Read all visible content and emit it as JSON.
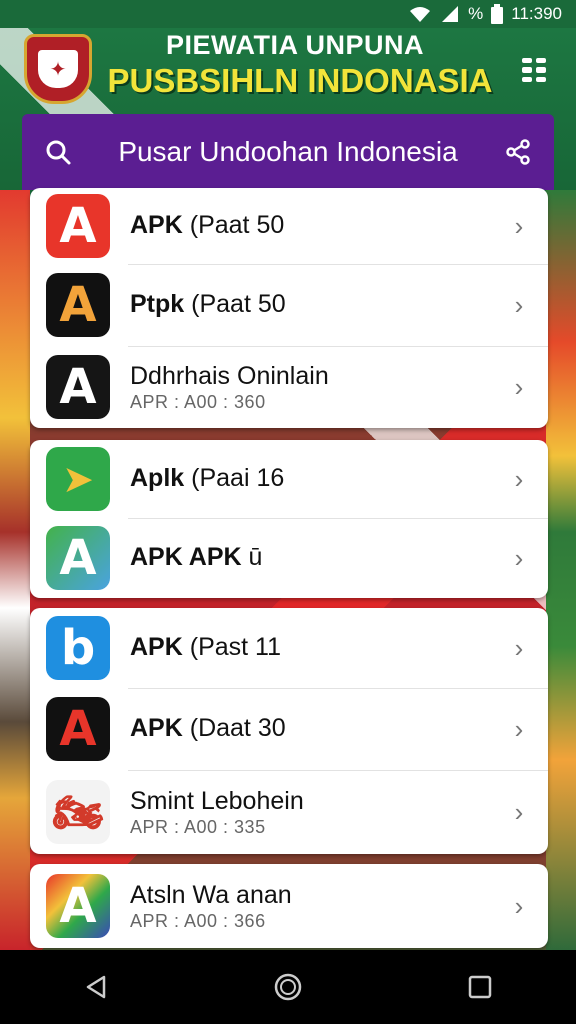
{
  "status_bar": {
    "percent": "%",
    "time": "11:390"
  },
  "header": {
    "line1": "PIEWATIA UNPUNA",
    "line2": "PUSBSIHLN INDONASIA"
  },
  "search_bar": {
    "title": "Pusar Undoohan Indonesia",
    "search_icon": "search-icon",
    "share_icon": "share-icon"
  },
  "cards": [
    {
      "items": [
        {
          "title_bold": "APK",
          "title_rest": " (Paat 50",
          "subtitle": "",
          "icon": "letter-a-red-icon",
          "icon_color": "#e8352a",
          "icon_letter": "A"
        },
        {
          "title_bold": "Ptpk",
          "title_rest": " (Paat 50",
          "subtitle": "",
          "icon": "letter-a-black-orange-icon",
          "icon_color": "#111111",
          "icon_letter": "A"
        },
        {
          "title_bold": "",
          "title_rest": "Ddhrhais Oninlain",
          "subtitle": "APR :  A00 : 360",
          "icon": "letter-a-black-white-icon",
          "icon_color": "#151515",
          "icon_letter": "A"
        }
      ]
    },
    {
      "items": [
        {
          "title_bold": "Aplk",
          "title_rest": " (Paai 16",
          "subtitle": "",
          "icon": "green-arrow-icon",
          "icon_color": "#2fa84a",
          "icon_letter": "➤"
        },
        {
          "title_bold": "APK APK",
          "title_rest": " ū",
          "subtitle": "",
          "icon": "letter-a-green-blue-icon",
          "icon_color": "#43b24a",
          "icon_letter": "A"
        }
      ]
    },
    {
      "items": [
        {
          "title_bold": "APK",
          "title_rest": " (Past 11",
          "subtitle": "",
          "icon": "letter-b-blue-icon",
          "icon_color": "#1f8fe0",
          "icon_letter": "b"
        },
        {
          "title_bold": "APK",
          "title_rest": " (Daat 30",
          "subtitle": "",
          "icon": "letter-a-black-red-icon",
          "icon_color": "#111111",
          "icon_letter": "A"
        },
        {
          "title_bold": "",
          "title_rest": "Smint Lebohein",
          "subtitle": "APR :  A00 : 335",
          "icon": "motorbike-icon",
          "icon_color": "#f3f3f3",
          "icon_letter": "🏍"
        }
      ]
    },
    {
      "items": [
        {
          "title_bold": "",
          "title_rest": "Atsln Wa anan",
          "subtitle": "APR :  A00 : 366",
          "icon": "letter-a-rainbow-icon",
          "icon_color": "#3a4ab8",
          "icon_letter": "A"
        }
      ]
    }
  ],
  "nav_bar": {
    "back_icon": "back-triangle-icon",
    "home_icon": "home-circle-icon",
    "recents_icon": "recents-square-icon"
  }
}
